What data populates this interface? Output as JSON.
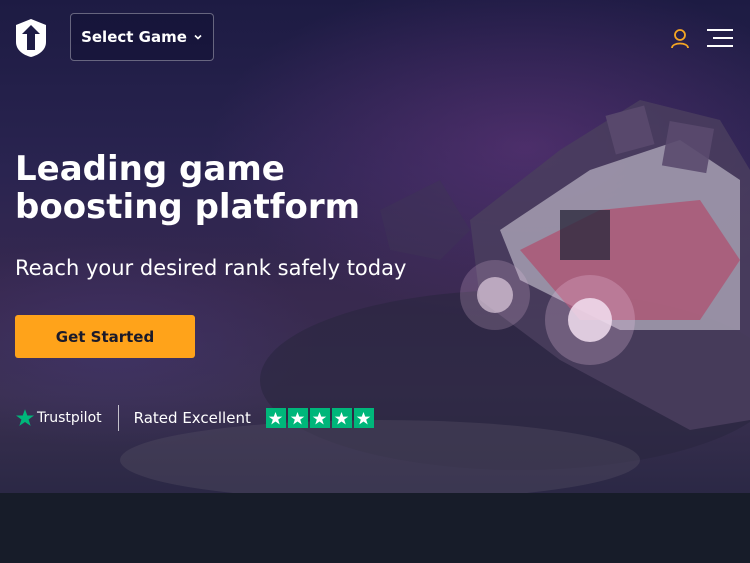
{
  "header": {
    "select_game_label": "Select Game",
    "logo_icon": "shield-arrow-logo",
    "user_icon": "user-icon",
    "menu_icon": "hamburger-menu-icon"
  },
  "hero": {
    "headline": "Leading game boosting platform",
    "subheadline": "Reach your desired rank safely today",
    "cta_label": "Get Started"
  },
  "trust": {
    "brand": "Trustpilot",
    "rating_text": "Rated Excellent",
    "stars": 5
  },
  "colors": {
    "accent": "#ffa31a",
    "trustpilot_green": "#00b67a",
    "user_icon": "#f5a623",
    "footer_bg": "#171c29"
  }
}
